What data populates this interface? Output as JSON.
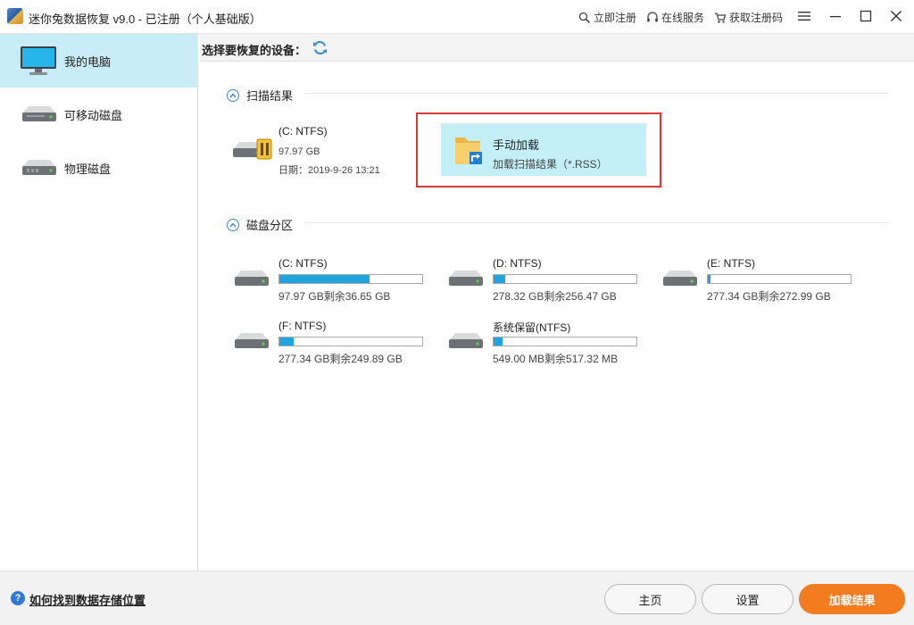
{
  "window": {
    "title": "迷你兔数据恢复 v9.0 - 已注册（个人基础版）",
    "links": {
      "register": "立即注册",
      "online_service": "在线服务",
      "get_code": "获取注册码"
    }
  },
  "sidebar": {
    "items": [
      {
        "label": "我的电脑",
        "icon": "monitor-icon",
        "active": true
      },
      {
        "label": "可移动磁盘",
        "icon": "removable-disk-icon",
        "active": false
      },
      {
        "label": "物理磁盘",
        "icon": "physical-disk-icon",
        "active": false
      }
    ]
  },
  "main": {
    "toolbar_label": "选择要恢复的设备：",
    "scan_section": "扫描结果",
    "scan_result": {
      "name": "(C: NTFS)",
      "size": "97.97 GB",
      "date": "日期：2019-9-26 13:21"
    },
    "manual_load": {
      "title": "手动加载",
      "subtitle": "加载扫描结果（*.RSS）"
    },
    "partitions_section": "磁盘分区",
    "partitions": [
      {
        "name": "(C: NTFS)",
        "size": "97.97 GB剩余36.65 GB",
        "used_fraction": 0.63
      },
      {
        "name": "(D: NTFS)",
        "size": "278.32 GB剩余256.47 GB",
        "used_fraction": 0.08
      },
      {
        "name": "(E: NTFS)",
        "size": "277.34 GB剩余272.99 GB",
        "used_fraction": 0.02
      },
      {
        "name": "(F: NTFS)",
        "size": "277.34 GB剩余249.89 GB",
        "used_fraction": 0.1
      },
      {
        "name": "系统保留(NTFS)",
        "size": "549.00 MB剩余517.32 MB",
        "used_fraction": 0.06
      }
    ]
  },
  "bottom": {
    "help_link": "如何找到数据存储位置",
    "home_label": "主页",
    "settings_label": "设置",
    "load_label": "加载结果"
  },
  "colors": {
    "accent": "#1ea5e0",
    "primary_button": "#f37b20",
    "sidebar_active": "#c8ecf8",
    "highlight_border": "#e03535"
  }
}
